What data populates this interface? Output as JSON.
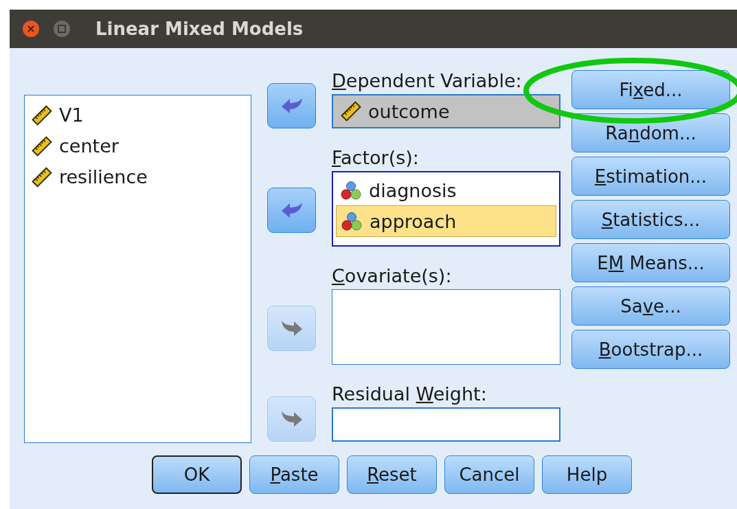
{
  "window": {
    "title": "Linear Mixed Models"
  },
  "variables": [
    {
      "name": "V1",
      "kind": "scale",
      "selected": false
    },
    {
      "name": "center",
      "kind": "scale",
      "selected": false
    },
    {
      "name": "resilience",
      "kind": "scale",
      "selected": false
    }
  ],
  "targets": [
    {
      "kind": "field",
      "arrow": {
        "kind": "left",
        "disabled": false
      },
      "label": [
        {
          "text": "D",
          "underline": true
        },
        {
          "text": "ependent Variable:",
          "underline": false
        }
      ],
      "items": [
        {
          "name": "outcome",
          "kind": "scale",
          "selected": false
        }
      ]
    },
    {
      "kind": "list",
      "arrow": {
        "kind": "left",
        "disabled": false
      },
      "label": [
        {
          "text": "F",
          "underline": true
        },
        {
          "text": "actor(s):",
          "underline": false
        }
      ],
      "items": [
        {
          "name": "diagnosis",
          "kind": "nominal",
          "selected": false
        },
        {
          "name": "approach",
          "kind": "nominal",
          "selected": true
        }
      ],
      "focused": true
    },
    {
      "kind": "list",
      "arrow": {
        "kind": "right",
        "disabled": true
      },
      "label": [
        {
          "text": "C",
          "underline": true
        },
        {
          "text": "ovariate(s):",
          "underline": false
        }
      ],
      "focused": false
    },
    {
      "kind": "field",
      "arrow": {
        "kind": "right",
        "disabled": true
      },
      "label": [
        {
          "text": "Residual ",
          "underline": false
        },
        {
          "text": "W",
          "underline": true
        },
        {
          "text": "eight:",
          "underline": false
        }
      ]
    }
  ],
  "side_buttons": [
    [
      {
        "text": "Fi",
        "underline": false
      },
      {
        "text": "x",
        "underline": true
      },
      {
        "text": "ed...",
        "underline": false
      }
    ],
    [
      {
        "text": "Ra",
        "underline": false
      },
      {
        "text": "n",
        "underline": true
      },
      {
        "text": "dom...",
        "underline": false
      }
    ],
    [
      {
        "text": "E",
        "underline": true
      },
      {
        "text": "stimation...",
        "underline": false
      }
    ],
    [
      {
        "text": "S",
        "underline": true
      },
      {
        "text": "tatistics...",
        "underline": false
      }
    ],
    [
      {
        "text": "E",
        "underline": false
      },
      {
        "text": "M",
        "underline": true
      },
      {
        "text": " Means...",
        "underline": false
      }
    ],
    [
      {
        "text": "Sa",
        "underline": false
      },
      {
        "text": "v",
        "underline": true
      },
      {
        "text": "e...",
        "underline": false
      }
    ],
    [
      {
        "text": "B",
        "underline": true
      },
      {
        "text": "ootstrap...",
        "underline": false
      }
    ]
  ],
  "bottom_buttons": [
    {
      "label": [
        {
          "text": "OK",
          "underline": false
        }
      ],
      "default": true
    },
    {
      "label": [
        {
          "text": "P",
          "underline": true
        },
        {
          "text": "aste",
          "underline": false
        }
      ],
      "default": false
    },
    {
      "label": [
        {
          "text": "R",
          "underline": true
        },
        {
          "text": "eset",
          "underline": false
        }
      ],
      "default": false
    },
    {
      "label": [
        {
          "text": "Cancel",
          "underline": false
        }
      ],
      "default": false
    },
    {
      "label": [
        {
          "text": "Help",
          "underline": false
        }
      ],
      "default": false
    }
  ],
  "annotation": {
    "kind": "ellipse"
  }
}
